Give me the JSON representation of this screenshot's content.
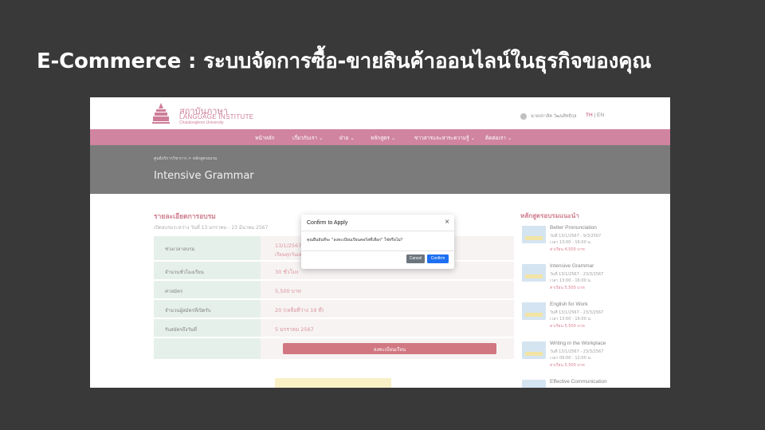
{
  "slide": {
    "title": "E-Commerce : ระบบจัดการซื้อ-ขายสินค้าออนไลน์ในธุรกิจของคุณ"
  },
  "site": {
    "logo_th": "สถาบันภาษา",
    "logo_en": "LANGUAGE INSTITUTE",
    "logo_uni": "Chulalongkorn University",
    "user_name": "นายปกาสิต วัฒนสิทธิกุล",
    "lang_th": "TH",
    "lang_sep": "|",
    "lang_en": "EN",
    "nav": [
      "หน้าหลัก",
      "เกี่ยวกับเรา ⌄",
      "ฝ่าย ⌄",
      "หลักสูตร ⌄",
      "ข่าวสารและสาระความรู้ ⌄",
      "ติดต่อเรา ⌄"
    ],
    "colors": {
      "brand": "#b33967",
      "dark": "#2b2b2b",
      "primary": "#1e6ff2"
    }
  },
  "hero": {
    "breadcrumb": "ศูนย์บริการวิชาการ  >  หลักสูตรอบรม",
    "title": "Intensive Grammar"
  },
  "details": {
    "title": "รายละเอียดการอบรม",
    "subtitle": "เปิดอบรมระหว่าง วันที่ 13 มกราคม - 23 มีนาคม 2567",
    "rows": [
      {
        "label": "ช่วงเวลาอบรม",
        "value": "13/1/2567",
        "value2": "เรียนทุกวันเสาร์"
      },
      {
        "label": "จำนวนชั่วโมงเรียน",
        "value": "30 ชั่วโมง"
      },
      {
        "label": "ค่าสมัคร",
        "value": "5,500 บาท"
      },
      {
        "label": "จำนวนผู้สมัครที่เปิดรับ",
        "value": "20 (เหลือที่ว่าง 19 ที่)"
      },
      {
        "label": "รับสมัครถึงวันที่",
        "value": "5 มกราคม 2567"
      }
    ],
    "register_label": "ลงทะเบียนเรียน"
  },
  "sidebar": {
    "title": "หลักสูตรอบรมแนะนำ",
    "cards": [
      {
        "title": "Better Pronunciation",
        "date": "วันที่ 13/1/2567 - 9/3/2567",
        "time": "เวลา 13:00 - 16:00 น.",
        "price": "ค่าเรียน 4,500 บาท"
      },
      {
        "title": "Intensive Grammar",
        "date": "วันที่ 13/1/2567 - 23/3/2567",
        "time": "เวลา 13:00 - 16:00 น.",
        "price": "ค่าเรียน 5,500 บาท"
      },
      {
        "title": "English for Work",
        "date": "วันที่ 13/1/2567 - 23/3/2567",
        "time": "เวลา 13:00 - 16:00 น.",
        "price": "ค่าเรียน 5,500 บาท"
      },
      {
        "title": "Writing in the Workplace",
        "date": "วันที่ 13/1/2567 - 23/3/2567",
        "time": "เวลา 09:00 - 12:00 น.",
        "price": "ค่าเรียน 5,500 บาท"
      },
      {
        "title": "Effective Communication",
        "date": "",
        "time": "",
        "price": ""
      }
    ]
  },
  "modal": {
    "title": "Confirm to Apply",
    "close": "×",
    "body": "คุณยืนยันที่จะ \"ลงทะเบียนเรียนคอร์สที่เลือก\" ใช่หรือไม่?",
    "cancel": "Cancel",
    "confirm": "Confirm"
  }
}
